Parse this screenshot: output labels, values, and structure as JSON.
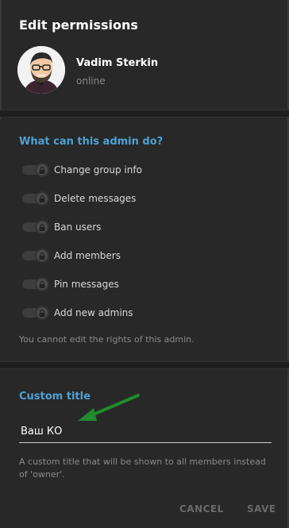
{
  "dialog": {
    "title": "Edit permissions",
    "user": {
      "name": "Vadim Sterkin",
      "status": "online"
    },
    "permissions_section": {
      "heading": "What can this admin do?",
      "items": [
        {
          "label": "Change group info",
          "enabled": true,
          "locked": true
        },
        {
          "label": "Delete messages",
          "enabled": true,
          "locked": true
        },
        {
          "label": "Ban users",
          "enabled": true,
          "locked": true
        },
        {
          "label": "Add members",
          "enabled": true,
          "locked": true
        },
        {
          "label": "Pin messages",
          "enabled": true,
          "locked": true
        },
        {
          "label": "Add new admins",
          "enabled": true,
          "locked": true
        }
      ],
      "note": "You cannot edit the rights of this admin."
    },
    "custom_title_section": {
      "heading": "Custom title",
      "value": "Ваш КО",
      "hint": "A custom title that will be shown to all members instead of 'owner'."
    },
    "buttons": {
      "cancel": "CANCEL",
      "save": "SAVE"
    }
  },
  "colors": {
    "accent": "#4ea1d3",
    "background": "#282828",
    "arrow": "#1f8a2e"
  },
  "icons": [
    "avatar",
    "lock-icon",
    "arrow-icon"
  ]
}
